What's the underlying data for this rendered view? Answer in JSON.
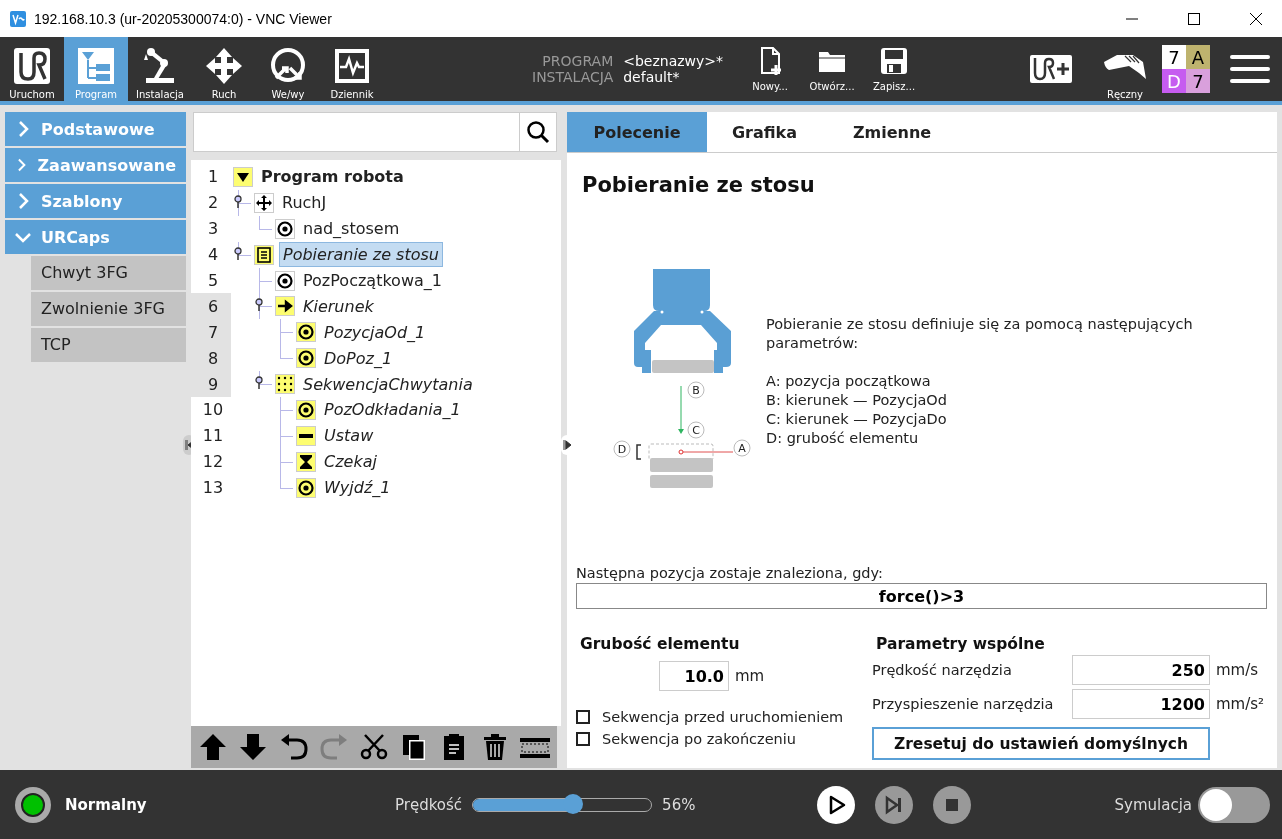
{
  "window": {
    "title": "192.168.10.3 (ur-20205300074:0) - VNC Viewer"
  },
  "toolbar": {
    "nav": [
      {
        "label": "Uruchom",
        "selected": false
      },
      {
        "label": "Program",
        "selected": true
      },
      {
        "label": "Instalacja",
        "selected": false
      },
      {
        "label": "Ruch",
        "selected": false
      },
      {
        "label": "We/wy",
        "selected": false
      },
      {
        "label": "Dziennik",
        "selected": false
      }
    ],
    "program_info": [
      {
        "label": "PROGRAM",
        "value": "<beznazwy>*"
      },
      {
        "label": "INSTALACJA",
        "value": "default*"
      }
    ],
    "file_buttons": [
      {
        "label": "Nowy..."
      },
      {
        "label": "Otwórz..."
      },
      {
        "label": "Zapisz..."
      }
    ],
    "mode": {
      "label": "Ręczny"
    },
    "status_grid": [
      {
        "text": "7",
        "color": "#ffffff"
      },
      {
        "text": "A",
        "color": "#beb36e"
      },
      {
        "text": "D",
        "color": "#c65cf0"
      },
      {
        "text": "7",
        "color": "#d9a0dc"
      }
    ]
  },
  "sidebar": {
    "items": [
      {
        "label": "Podstawowe",
        "expanded": false
      },
      {
        "label": "Zaawansowane",
        "expanded": false
      },
      {
        "label": "Szablony",
        "expanded": false
      },
      {
        "label": "URCaps",
        "expanded": true,
        "children": [
          {
            "label": "Chwyt 3FG"
          },
          {
            "label": "Zwolnienie 3FG"
          },
          {
            "label": "TCP"
          }
        ]
      }
    ]
  },
  "tree": [
    {
      "line": "1",
      "label": "Program robota",
      "kind": "program",
      "flagged": true,
      "italic": false,
      "selected": false,
      "shaded": false,
      "children": [
        {
          "line": "2",
          "label": "RuchJ",
          "kind": "move",
          "flagged": false,
          "italic": false,
          "selected": false,
          "shaded": false,
          "children": [
            {
              "line": "3",
              "label": "nad_stosem",
              "kind": "waypoint",
              "flagged": false,
              "italic": false,
              "selected": false,
              "shaded": false
            }
          ]
        },
        {
          "line": "4",
          "label": "Pobieranie ze stosu",
          "kind": "stack",
          "flagged": true,
          "italic": true,
          "selected": true,
          "shaded": false,
          "children": [
            {
              "line": "5",
              "label": "PozPoczątkowa_1",
              "kind": "waypoint",
              "flagged": false,
              "italic": false,
              "selected": false,
              "shaded": false
            },
            {
              "line": "6",
              "label": "Kierunek",
              "kind": "direction",
              "flagged": true,
              "italic": true,
              "selected": false,
              "shaded": true,
              "children": [
                {
                  "line": "7",
                  "label": "PozycjaOd_1",
                  "kind": "waypoint",
                  "flagged": true,
                  "italic": true,
                  "selected": false,
                  "shaded": true
                },
                {
                  "line": "8",
                  "label": "DoPoz_1",
                  "kind": "waypoint",
                  "flagged": true,
                  "italic": true,
                  "selected": false,
                  "shaded": true
                }
              ]
            },
            {
              "line": "9",
              "label": "SekwencjaChwytania",
              "kind": "sequence",
              "flagged": true,
              "italic": true,
              "selected": false,
              "shaded": true,
              "children": [
                {
                  "line": "10",
                  "label": "PozOdkładania_1",
                  "kind": "waypoint",
                  "flagged": true,
                  "italic": true,
                  "selected": false,
                  "shaded": false
                },
                {
                  "line": "11",
                  "label": "Ustaw",
                  "kind": "set",
                  "flagged": true,
                  "italic": true,
                  "selected": false,
                  "shaded": false
                },
                {
                  "line": "12",
                  "label": "Czekaj",
                  "kind": "wait",
                  "flagged": true,
                  "italic": true,
                  "selected": false,
                  "shaded": false
                },
                {
                  "line": "13",
                  "label": "Wyjdź_1",
                  "kind": "waypoint",
                  "flagged": true,
                  "italic": true,
                  "selected": false,
                  "shaded": false
                }
              ]
            }
          ]
        }
      ]
    }
  ],
  "tree_tools": [
    {
      "kind": "up",
      "disabled": false
    },
    {
      "kind": "down",
      "disabled": false
    },
    {
      "kind": "undo",
      "disabled": false
    },
    {
      "kind": "redo",
      "disabled": true
    },
    {
      "kind": "cut",
      "disabled": false
    },
    {
      "kind": "copy",
      "disabled": false
    },
    {
      "kind": "paste",
      "disabled": false
    },
    {
      "kind": "delete",
      "disabled": false
    },
    {
      "kind": "suppress",
      "disabled": false
    }
  ],
  "tabs": [
    {
      "label": "Polecenie",
      "selected": true
    },
    {
      "label": "Grafika",
      "selected": false
    },
    {
      "label": "Zmienne",
      "selected": false
    }
  ],
  "command": {
    "heading": "Pobieranie ze stosu",
    "diagram_labels": [
      "B",
      "C",
      "D",
      "A"
    ],
    "description": "Pobieranie ze stosu definiuje się za pomocą następujących parametrów:",
    "legend": [
      "A: pozycja początkowa",
      "B: kierunek — PozycjaOd",
      "C: kierunek — PozycjaDo",
      "D: grubość elementu"
    ],
    "condition": {
      "label": "Następna pozycja zostaje znaleziona, gdy:",
      "value": "force()>3"
    },
    "thickness": {
      "title": "Grubość elementu",
      "value": "10.0",
      "unit": "mm"
    },
    "checkboxes": [
      {
        "label": "Sekwencja przed uruchomieniem",
        "checked": false
      },
      {
        "label": "Sekwencja po zakończeniu",
        "checked": false
      }
    ],
    "shared": {
      "title": "Parametry wspólne",
      "rows": [
        {
          "label": "Prędkość narzędzia",
          "value": "250",
          "unit": "mm/s"
        },
        {
          "label": "Przyspieszenie narzędzia",
          "value": "1200",
          "unit": "mm/s²"
        }
      ]
    },
    "reset_button": "Zresetuj do ustawień domyślnych"
  },
  "footer": {
    "status": {
      "label": "Normalny",
      "color": "#00c000"
    },
    "speed": {
      "label": "Prędkość",
      "level": 0.56,
      "reading": "56%"
    },
    "simulation": {
      "label": "Symulacja",
      "on": false
    }
  }
}
